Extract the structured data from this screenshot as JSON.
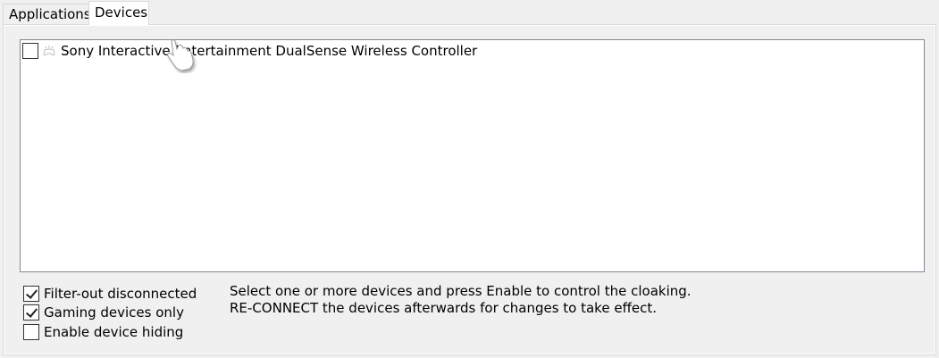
{
  "tabs": {
    "applications": "Applications",
    "devices": "Devices"
  },
  "device_list": {
    "items": [
      {
        "label": "Sony Interactive Entertainment DualSense Wireless Controller",
        "checked": false,
        "icon": "gamepad-icon"
      }
    ]
  },
  "options": {
    "filter_disconnected": {
      "label": "Filter-out disconnected",
      "checked": true
    },
    "gaming_only": {
      "label": "Gaming devices only",
      "checked": true
    },
    "enable_hiding": {
      "label": "Enable device hiding",
      "checked": false
    }
  },
  "info": {
    "line1": "Select one or more devices and press Enable to control the cloaking.",
    "line2": "RE-CONNECT the devices afterwards for changes to take effect."
  }
}
